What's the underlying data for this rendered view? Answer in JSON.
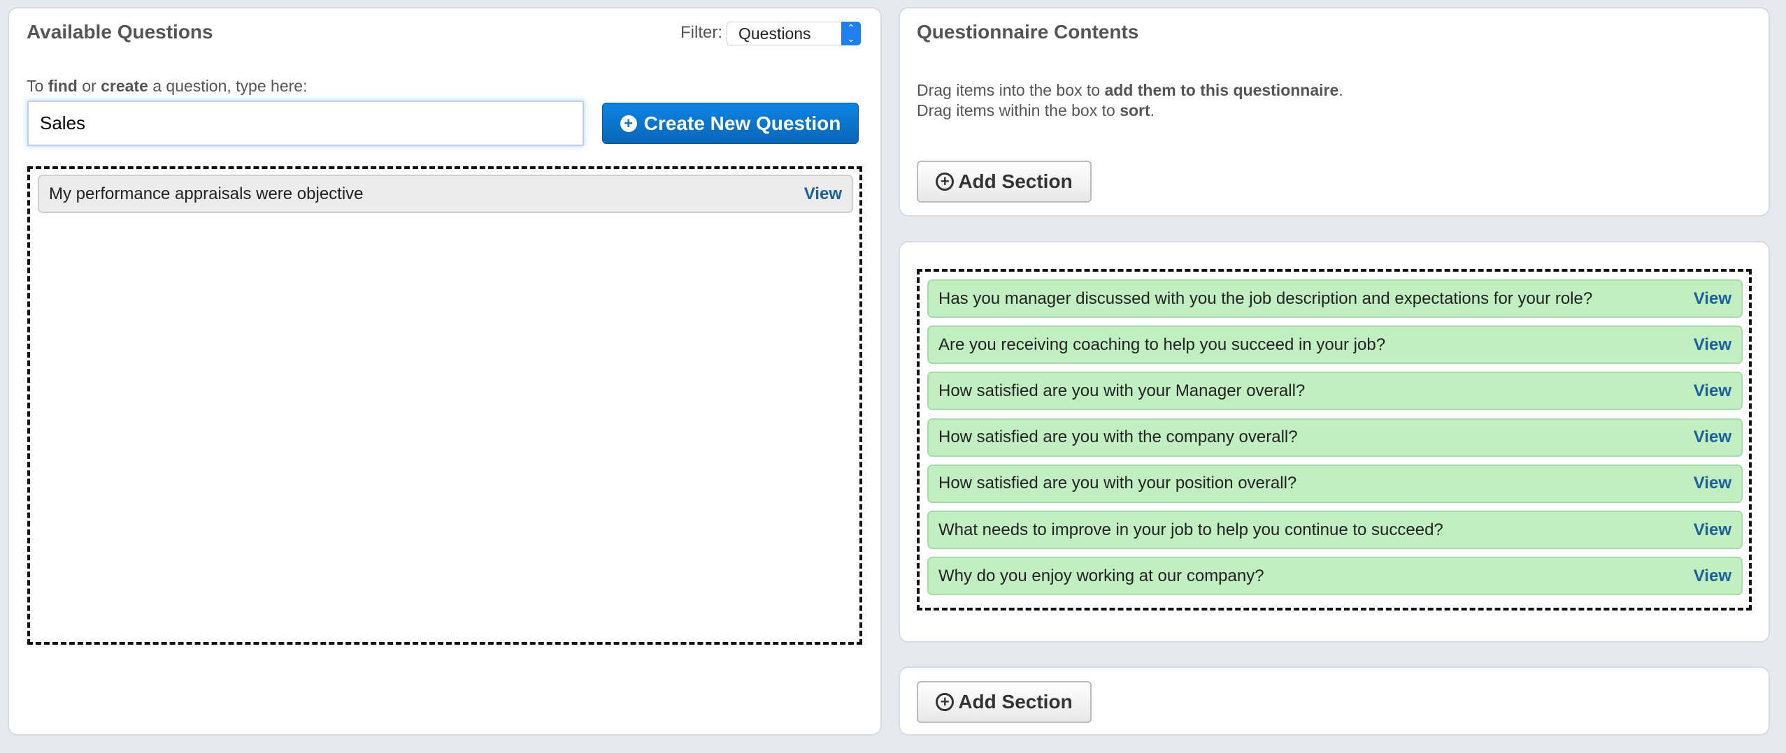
{
  "available": {
    "title": "Available Questions",
    "filter_label": "Filter:",
    "filter_value": "Questions",
    "hint": {
      "p1": "To ",
      "b1": "find",
      "p2": " or ",
      "b2": "create",
      "p3": " a question, type here:"
    },
    "search_value": "Sales",
    "create_button": "Create New Question",
    "items": [
      {
        "text": "My performance appraisals were objective",
        "view": "View"
      }
    ]
  },
  "contents": {
    "title": "Questionnaire Contents",
    "line1": {
      "p1": "Drag items into the box to ",
      "b1": "add them to this questionnaire",
      "p2": "."
    },
    "line2": {
      "p1": "Drag items within the box to ",
      "b1": "sort",
      "p2": "."
    },
    "add_section": "Add Section",
    "items": [
      {
        "text": "Has you manager discussed with you the job description and expectations for your role?",
        "view": "View"
      },
      {
        "text": "Are you receiving coaching to help you succeed in your job?",
        "view": "View"
      },
      {
        "text": "How satisfied are you with your Manager overall?",
        "view": "View"
      },
      {
        "text": "How satisfied are you with the company overall?",
        "view": "View"
      },
      {
        "text": "How satisfied are you with your position overall?",
        "view": "View"
      },
      {
        "text": "What needs to improve in your job to help you continue to succeed?",
        "view": "View"
      },
      {
        "text": "Why do you enjoy working at our company?",
        "view": "View"
      }
    ],
    "add_section_bottom": "Add Section"
  },
  "colors": {
    "primary_button": "#0a72c8",
    "item_green": "#c2efc2",
    "link": "#1a5f9e"
  }
}
